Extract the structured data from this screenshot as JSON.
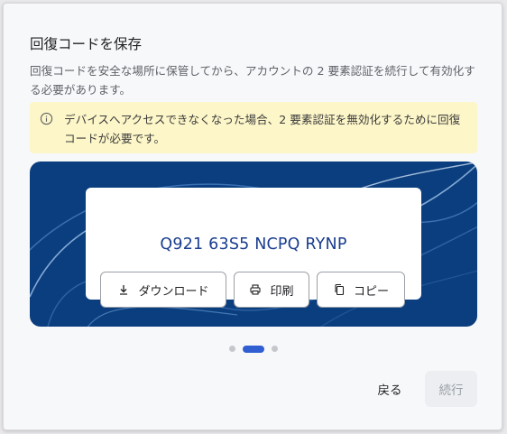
{
  "dialog": {
    "title": "回復コードを保存",
    "description": "回復コードを安全な場所に保管してから、アカウントの 2 要素認証を続行して有効化する必要があります。",
    "warning": {
      "icon": "info-icon",
      "text": "デバイスへアクセスできなくなった場合、2 要素認証を無効化するために回復コードが必要です。"
    },
    "recovery_code": "Q921 63S5 NCPQ RYNP",
    "actions": {
      "download_label": "ダウンロード",
      "print_label": "印刷",
      "copy_label": "コピー"
    },
    "pagination": {
      "total": 3,
      "current": 2
    },
    "footer": {
      "back_label": "戻る",
      "next_label": "続行"
    }
  },
  "colors": {
    "panel_bg": "#0b3e7e",
    "code_text": "#1a3d8f",
    "warning_bg": "#fdf6c8",
    "active_dot": "#2f5fd0"
  }
}
